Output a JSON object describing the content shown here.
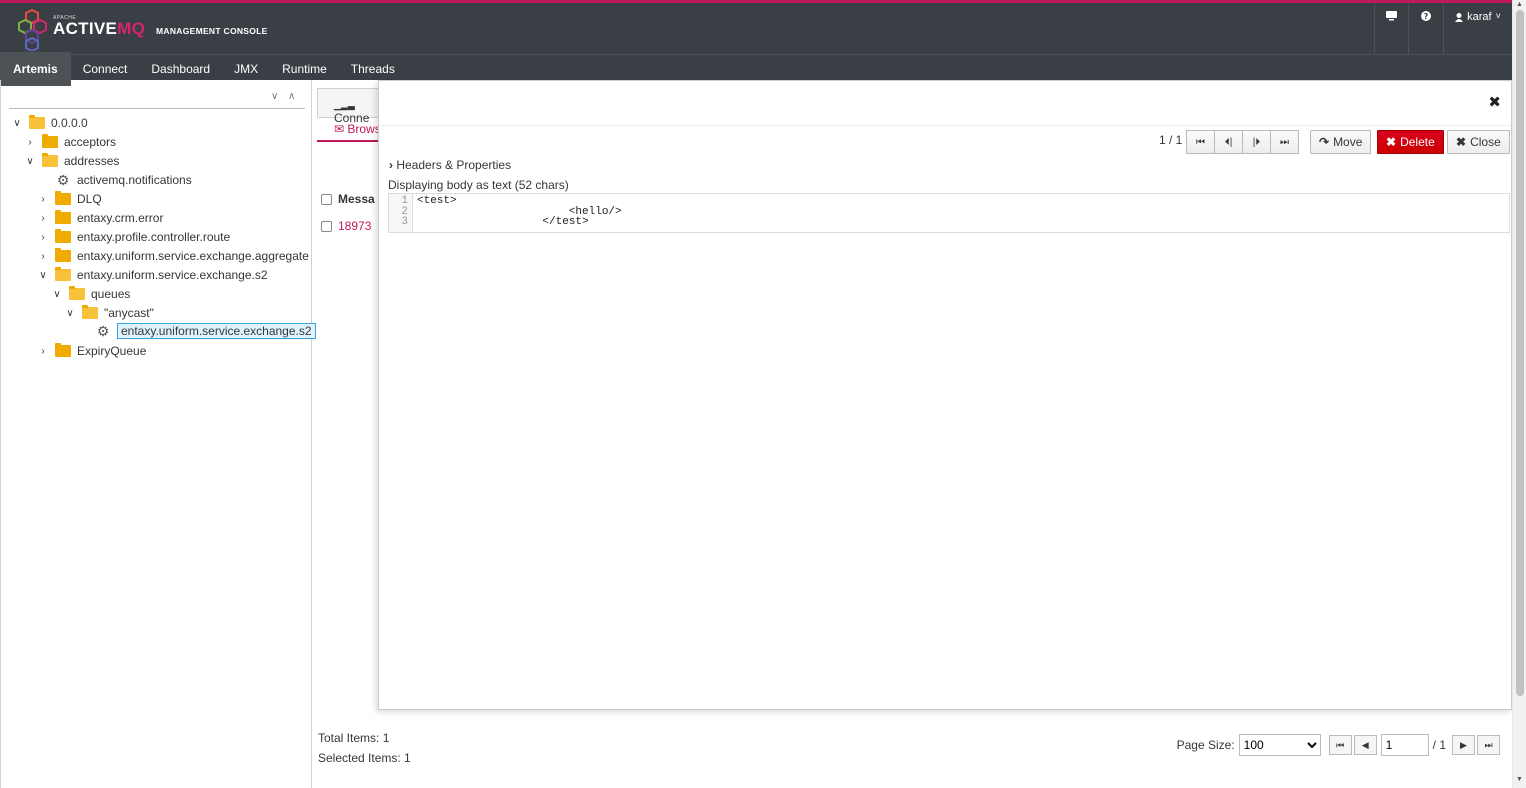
{
  "header": {
    "logo": {
      "apache": "APACHE",
      "active": "ACTIVE",
      "mq": "MQ",
      "console": "MANAGEMENT CONSOLE"
    },
    "user": "karaf"
  },
  "nav": [
    "Artemis",
    "Connect",
    "Dashboard",
    "JMX",
    "Runtime",
    "Threads"
  ],
  "tree": {
    "nodes": [
      {
        "label": "0.0.0.0",
        "icon": "folder-open-icon",
        "chevron": "down"
      },
      {
        "label": "acceptors",
        "icon": "folder-icon",
        "chevron": "right"
      },
      {
        "label": "addresses",
        "icon": "folder-open-icon",
        "chevron": "down"
      },
      {
        "label": "activemq.notifications",
        "icon": "gear-icon",
        "chevron": ""
      },
      {
        "label": "DLQ",
        "icon": "folder-icon",
        "chevron": "right"
      },
      {
        "label": "entaxy.crm.error",
        "icon": "folder-icon",
        "chevron": "right"
      },
      {
        "label": "entaxy.profile.controller.route",
        "icon": "folder-icon",
        "chevron": "right"
      },
      {
        "label": "entaxy.uniform.service.exchange.aggregate",
        "icon": "folder-icon",
        "chevron": "right"
      },
      {
        "label": "entaxy.uniform.service.exchange.s2",
        "icon": "folder-open-icon",
        "chevron": "down"
      },
      {
        "label": "queues",
        "icon": "folder-open-icon",
        "chevron": "down"
      },
      {
        "label": "\"anycast\"",
        "icon": "folder-open-icon",
        "chevron": "down"
      },
      {
        "label": "entaxy.uniform.service.exchange.s2",
        "icon": "gear-icon",
        "chevron": ""
      },
      {
        "label": "ExpiryQueue",
        "icon": "folder-icon",
        "chevron": "right"
      }
    ]
  },
  "browser": {
    "tab_connect": "Conne",
    "tab_browse": "Brows",
    "col_message": "Messa",
    "row_id": "18973",
    "total_items": "Total Items: 1",
    "selected_items": "Selected Items: 1",
    "page_size_label": "Page Size:",
    "page_size": "100",
    "page_input": "1",
    "page_of": "/ 1"
  },
  "modal": {
    "counter": "1 / 1",
    "move": "Move",
    "delete": "Delete",
    "close": "Close",
    "headers_toggle": "Headers & Properties",
    "body_info": "Displaying body as text (52 chars)",
    "lines": [
      "1",
      "2",
      "3"
    ],
    "code": "<test>\n                       <hello/>\n                   </test>"
  },
  "colors": {
    "accent": "#c0185c",
    "topbar": "#393f44",
    "danger": "#cc0000"
  }
}
